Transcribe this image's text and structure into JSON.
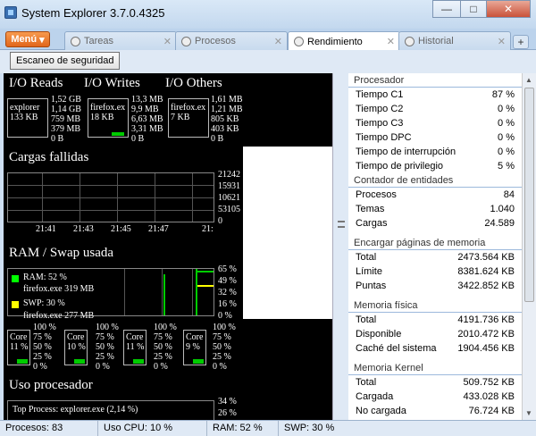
{
  "window": {
    "title": "System Explorer 3.7.0.4325",
    "min_glyph": "—",
    "max_glyph": "□",
    "close_glyph": "✕"
  },
  "menu_button": {
    "label": "Menú"
  },
  "tabs": [
    {
      "label": "Tareas",
      "active": false
    },
    {
      "label": "Procesos",
      "active": false
    },
    {
      "label": "Rendimiento",
      "active": true
    },
    {
      "label": "Historial",
      "active": false
    }
  ],
  "toolbar": {
    "scan_label": "Escaneo de seguridad"
  },
  "io": {
    "reads": {
      "title": "I/O Reads",
      "process": "explorer",
      "value": "133 KB",
      "axis": [
        "1,52 GB",
        "1,14 GB",
        "759 MB",
        "379 MB",
        "0 B"
      ]
    },
    "writes": {
      "title": "I/O Writes",
      "process": "firefox.ex",
      "value": "18 KB",
      "axis": [
        "13,3 MB",
        "9,9 MB",
        "6,63 MB",
        "3,31 MB",
        "0 B"
      ]
    },
    "others": {
      "title": "I/O Others",
      "process": "firefox.ex",
      "value": "7 KB",
      "axis": [
        "1,61 MB",
        "1,21 MB",
        "805 KB",
        "403 KB",
        "0 B"
      ]
    }
  },
  "faults": {
    "title": "Cargas fallidas",
    "axis": [
      "21242",
      "15931",
      "10621",
      "53105",
      "0"
    ],
    "times": [
      "21:41",
      "21:43",
      "21:45",
      "21:47",
      "21:"
    ]
  },
  "ram": {
    "title": "RAM / Swap usada",
    "ram_label": "RAM: 52 %",
    "ram_proc": "firefox.exe 319 MB",
    "swp_label": "SWP: 30 %",
    "swp_proc": "firefox.exe 277 MB",
    "axis": [
      "65 %",
      "49 %",
      "32 %",
      "16 %",
      "0 %"
    ],
    "ram_color": "#00ff00",
    "swp_color": "#ffff00"
  },
  "cores": [
    {
      "name": "Core",
      "pct": "11 %"
    },
    {
      "name": "Core",
      "pct": "10 %"
    },
    {
      "name": "Core",
      "pct": "11 %"
    },
    {
      "name": "Core",
      "pct": "9 %"
    }
  ],
  "core_axis": [
    "100 %",
    "75 %",
    "50 %",
    "25 %",
    "0 %"
  ],
  "cpu": {
    "title": "Uso procesador",
    "top_process": "Top Process: explorer.exe (2,14 %)",
    "axis": [
      "34 %",
      "26 %"
    ]
  },
  "panels": [
    {
      "header": "Procesador",
      "rows": [
        [
          "Tiempo C1",
          "87 %"
        ],
        [
          "Tiempo C2",
          "0 %"
        ],
        [
          "Tiempo C3",
          "0 %"
        ],
        [
          "Tiempo DPC",
          "0 %"
        ],
        [
          "Tiempo de interrupción",
          "0 %"
        ],
        [
          "Tiempo de privilegio",
          "5 %"
        ]
      ]
    },
    {
      "header": "Contador de entidades",
      "rows": [
        [
          "Procesos",
          "84"
        ],
        [
          "Temas",
          "1.040"
        ],
        [
          "Cargas",
          "24.589"
        ]
      ]
    },
    {
      "header": "Encargar páginas de memoria",
      "rows": [
        [
          "Total",
          "2473.564 KB"
        ],
        [
          "Límite",
          "8381.624 KB"
        ],
        [
          "Puntas",
          "3422.852 KB"
        ]
      ]
    },
    {
      "header": "Memoria física",
      "rows": [
        [
          "Total",
          "4191.736 KB"
        ],
        [
          "Disponible",
          "2010.472 KB"
        ],
        [
          "Caché del sistema",
          "1904.456 KB"
        ]
      ]
    },
    {
      "header": "Memoria Kernel",
      "rows": [
        [
          "Total",
          "509.752 KB"
        ],
        [
          "Cargada",
          "433.028 KB"
        ],
        [
          "No cargada",
          "76.724 KB"
        ]
      ]
    }
  ],
  "status": {
    "procs": "Procesos: 83",
    "cpu": "Uso CPU: 10 %",
    "ram": "RAM: 52 %",
    "swp": "SWP: 30 %"
  }
}
